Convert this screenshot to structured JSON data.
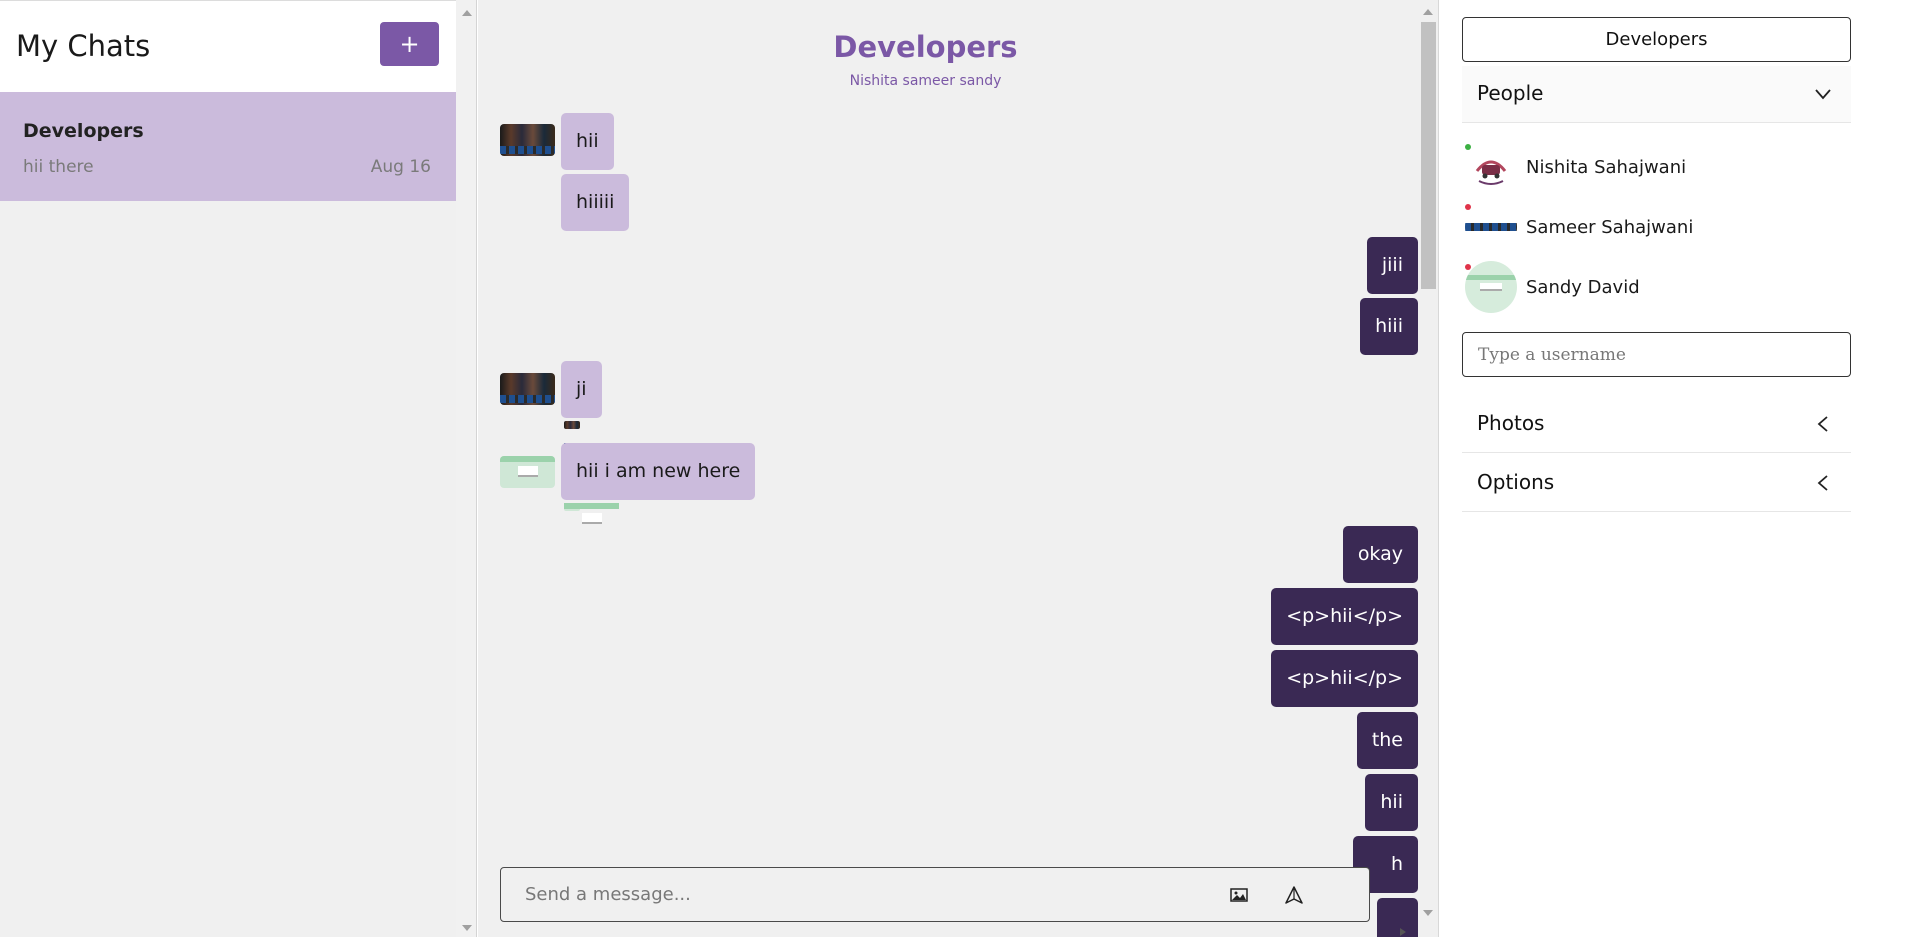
{
  "sidebar": {
    "title": "My Chats",
    "new_chat_label": "+",
    "chats": [
      {
        "title": "Developers",
        "last_message": "hii there",
        "date": "Aug 16"
      }
    ]
  },
  "chat": {
    "title": "Developers",
    "subtitle": "Nishita sameer sandy",
    "messages": [
      {
        "text": "hii",
        "direction": "in"
      },
      {
        "text": "hiiiii",
        "direction": "in"
      },
      {
        "text": "jiii",
        "direction": "out"
      },
      {
        "text": "hiii",
        "direction": "out"
      },
      {
        "text": "ji",
        "direction": "in"
      },
      {
        "text": "hii i am new here",
        "direction": "in"
      },
      {
        "text": "okay",
        "direction": "out"
      },
      {
        "text": "<p>hii</p>",
        "direction": "out"
      },
      {
        "text": "<p>hii</p>",
        "direction": "out"
      },
      {
        "text": "the",
        "direction": "out"
      },
      {
        "text": "hii",
        "direction": "out"
      },
      {
        "text": "h",
        "direction": "out"
      }
    ],
    "composer_placeholder": "Send a message..."
  },
  "details": {
    "group_name": "Developers",
    "people_label": "People",
    "people": [
      {
        "name": "Nishita Sahajwani",
        "status": "online"
      },
      {
        "name": "Sameer Sahajwani",
        "status": "offline"
      },
      {
        "name": "Sandy David",
        "status": "offline"
      }
    ],
    "username_placeholder": "Type a username",
    "photos_label": "Photos",
    "options_label": "Options"
  },
  "colors": {
    "accent": "#7b58a6",
    "incoming_bubble": "#cbbbdc",
    "outgoing_bubble": "#3a2954",
    "online": "#3cb043",
    "offline": "#e0344a"
  }
}
